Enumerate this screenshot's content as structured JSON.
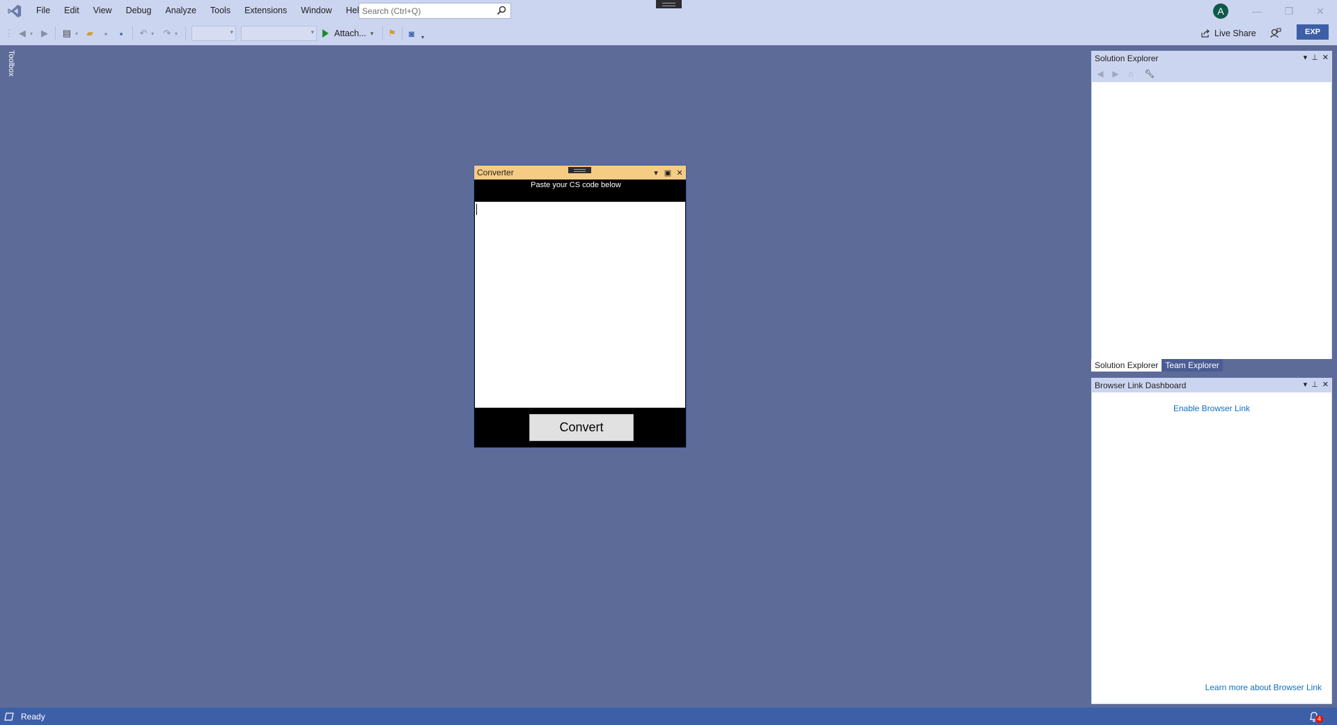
{
  "menubar": {
    "items": [
      "File",
      "Edit",
      "View",
      "Debug",
      "Analyze",
      "Tools",
      "Extensions",
      "Window",
      "Help"
    ],
    "search_placeholder": "Search (Ctrl+Q)",
    "avatar_initial": "A"
  },
  "toolbar": {
    "attach_label": "Attach...",
    "live_share_label": "Live Share",
    "exp_badge": "EXP"
  },
  "toolbox": {
    "label": "Toolbox"
  },
  "converter": {
    "title": "Converter",
    "header": "Paste your CS code below",
    "code_value": "",
    "convert_label": "Convert"
  },
  "solution_explorer": {
    "title": "Solution Explorer",
    "tabs": [
      "Solution Explorer",
      "Team Explorer"
    ]
  },
  "browser_link": {
    "title": "Browser Link Dashboard",
    "enable_link": "Enable Browser Link",
    "learn_link": "Learn more about Browser Link"
  },
  "statusbar": {
    "text": "Ready",
    "notification_count": "4"
  },
  "colors": {
    "workspace": "#5d6b99",
    "chrome": "#ccd5f0",
    "accent": "#3d5fa8",
    "converter_title": "#f5cc84",
    "link": "#0e70c0"
  }
}
